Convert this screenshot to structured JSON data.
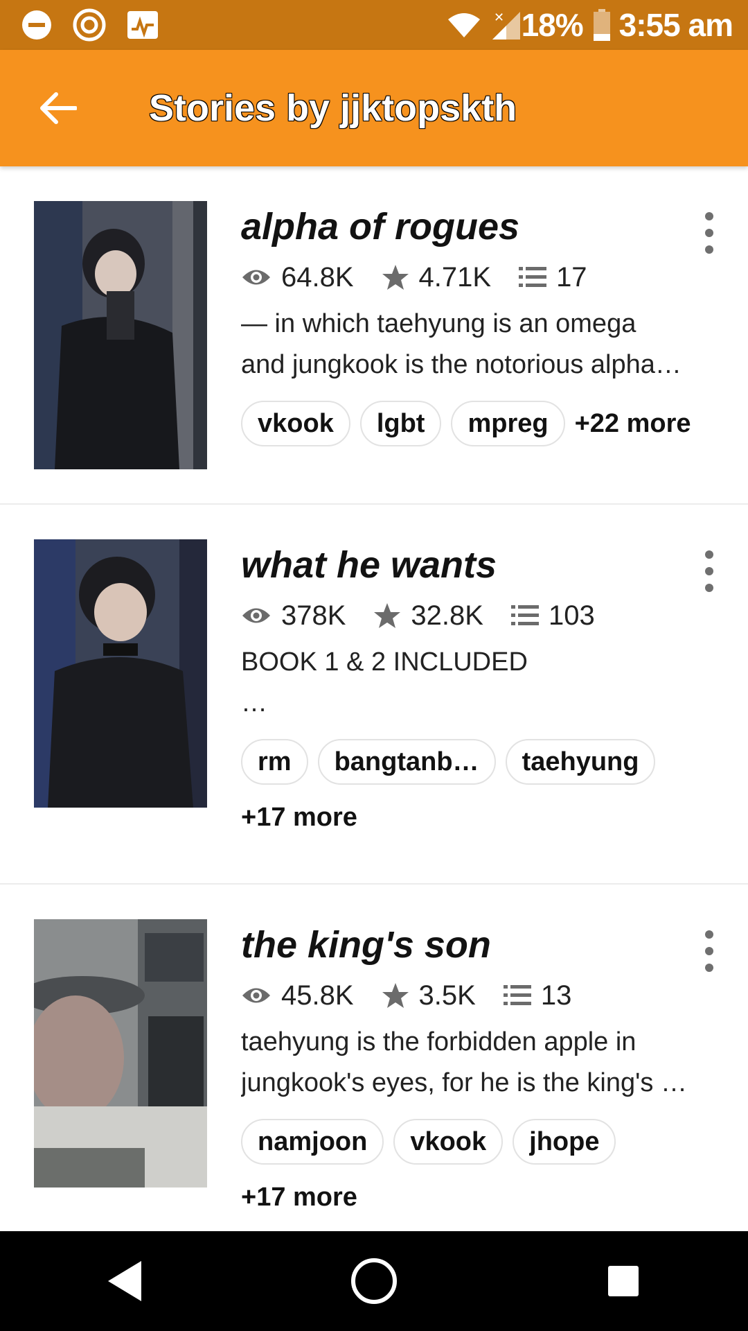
{
  "status_bar": {
    "battery": "18%",
    "time": "3:55 am",
    "icons": [
      "do-not-disturb-icon",
      "sync-icon",
      "activity-icon",
      "wifi-icon",
      "signal-icon",
      "battery-icon"
    ]
  },
  "app_bar": {
    "title": "Stories by jjktopskth",
    "back_icon": "arrow-left-icon"
  },
  "colors": {
    "status_bar": "#c67612",
    "app_bar": "#f6921e",
    "nav_bar": "#000000"
  },
  "stories": [
    {
      "title": "alpha of rogues",
      "reads": "64.8K",
      "votes": "4.71K",
      "parts": "17",
      "description_lines": [
        "— in which taehyung is an omega",
        "and jungkook is the notorious alpha…"
      ],
      "tags": [
        "vkook",
        "lgbt",
        "mpreg"
      ],
      "more": "+22 more"
    },
    {
      "title": "what he wants",
      "reads": "378K",
      "votes": "32.8K",
      "parts": "103",
      "description_lines": [
        "BOOK 1 & 2 INCLUDED",
        "…"
      ],
      "tags": [
        "rm",
        "bangtanb…",
        "taehyung"
      ],
      "more": "+17 more"
    },
    {
      "title": "the king's son",
      "reads": "45.8K",
      "votes": "3.5K",
      "parts": "13",
      "description_lines": [
        "taehyung is the forbidden apple in",
        "jungkook's eyes, for he is the king's …"
      ],
      "tags": [
        "namjoon",
        "vkook",
        "jhope"
      ],
      "more": "+17 more"
    }
  ],
  "nav_bar": {
    "icons": [
      "back-triangle-icon",
      "home-circle-icon",
      "recents-square-icon"
    ]
  }
}
